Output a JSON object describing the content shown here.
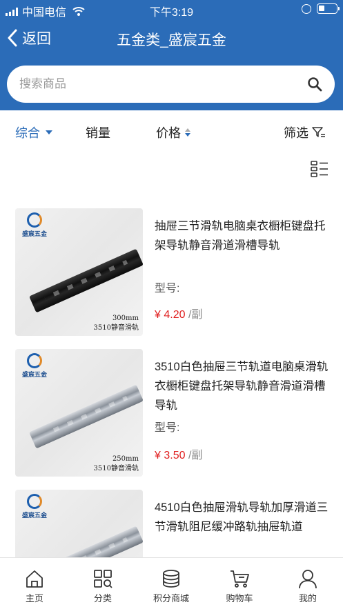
{
  "status_bar": {
    "carrier": "中国电信",
    "time": "下午3:19"
  },
  "nav": {
    "back_label": "返回",
    "title": "五金类_盛宸五金"
  },
  "search": {
    "placeholder": "搜索商品"
  },
  "sort_bar": {
    "items": [
      "综合",
      "销量",
      "价格",
      "筛选"
    ]
  },
  "products": [
    {
      "title": "抽屉三节滑轨电脑桌衣橱柜键盘托架导轨静音滑道滑槽导轨",
      "model_label": "型号:",
      "currency": "¥",
      "price": "4.20",
      "unit": "/副",
      "image_caption_1": "300mm",
      "image_caption_2": "3510静音滑轨",
      "image_brand": "盛宸五金"
    },
    {
      "title": "3510白色抽屉三节轨道电脑桌滑轨衣橱柜键盘托架导轨静音滑道滑槽导轨",
      "model_label": "型号:",
      "currency": "¥",
      "price": "3.50",
      "unit": "/副",
      "image_caption_1": "250mm",
      "image_caption_2": "3510静音滑轨",
      "image_brand": "盛宸五金"
    },
    {
      "title": "4510白色抽屉滑轨导轨加厚滑道三节滑轨阻尼缓冲路轨抽屉轨道",
      "image_brand": "盛宸五金"
    }
  ],
  "tab_bar": {
    "items": [
      {
        "label": "主页",
        "icon": "home-icon"
      },
      {
        "label": "分类",
        "icon": "category-grid-icon"
      },
      {
        "label": "积分商城",
        "icon": "coin-stack-icon"
      },
      {
        "label": "购物车",
        "icon": "cart-icon"
      },
      {
        "label": "我的",
        "icon": "user-icon"
      }
    ]
  },
  "colors": {
    "primary": "#2b6cb8",
    "price": "#e02020"
  }
}
